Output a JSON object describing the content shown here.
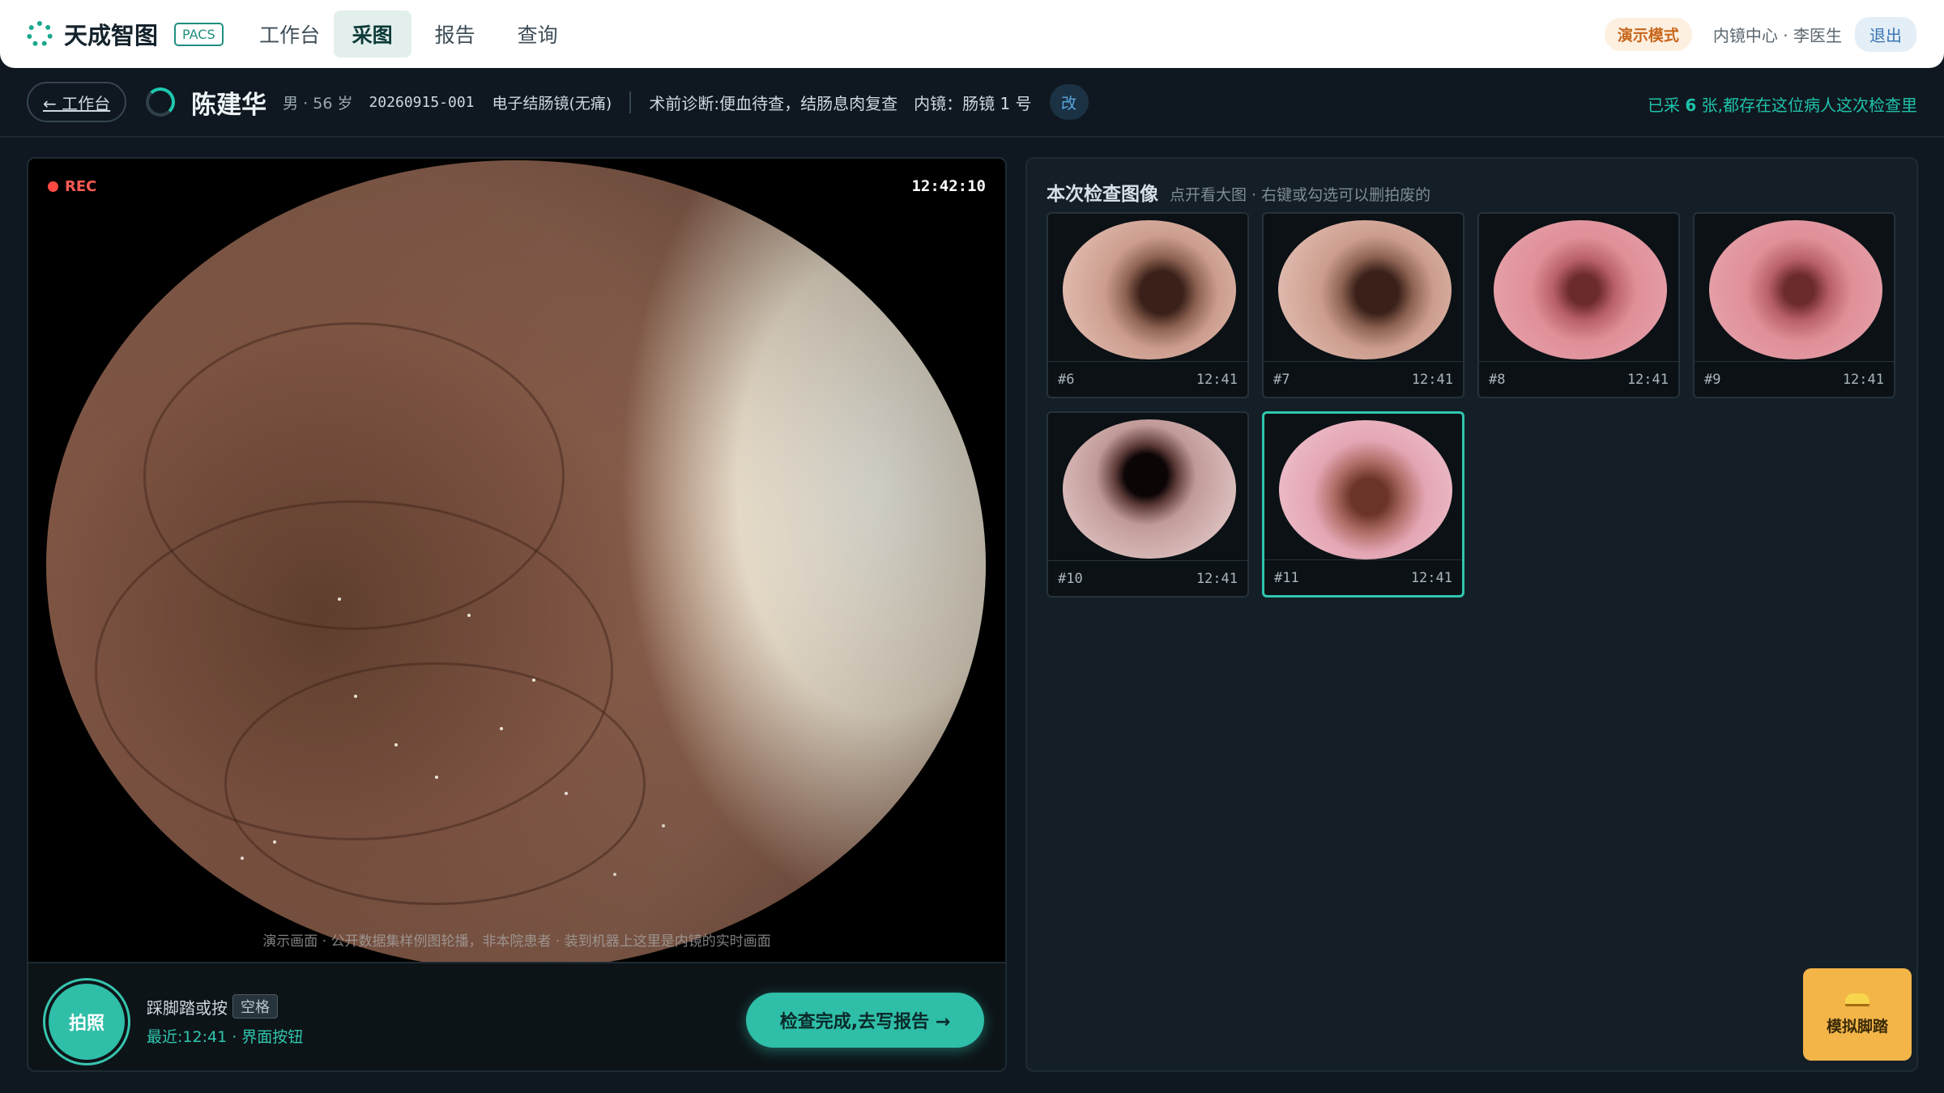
{
  "app": {
    "name": "天成智图",
    "tag": "PACS"
  },
  "nav": {
    "items": [
      {
        "label": "工作台",
        "active": false
      },
      {
        "label": "采图",
        "active": true
      },
      {
        "label": "报告",
        "active": false
      },
      {
        "label": "查询",
        "active": false
      }
    ]
  },
  "top_right": {
    "demo_mode": "演示模式",
    "user": "内镜中心 · 李医生",
    "logout": "退出"
  },
  "patient": {
    "back_label": "← 工作台",
    "name": "陈建华",
    "meta": "男 · 56 岁",
    "exam_id": "20260915-001",
    "exam_type": "电子结肠镜(无痛)",
    "diagnosis": "术前诊断:便血待查，结肠息肉复查",
    "scope": "内镜：肠镜 1 号",
    "edit_label": "改",
    "captured_prefix": "已采",
    "captured_count": "6",
    "captured_suffix": "张,都存在这位病人这次检查里"
  },
  "video": {
    "rec_label": "REC",
    "time": "12:42:10",
    "caption": "演示画面 · 公开数据集样例图轮播，非本院患者 · 装到机器上这里是内镜的实时画面"
  },
  "controls": {
    "shoot_label": "拍照",
    "pedal_hint": "踩脚踏或按",
    "space_key": "空格",
    "last_shot": "最近:12:41 · 界面按钮",
    "finish_label": "检查完成,去写报告 →"
  },
  "gallery": {
    "title": "本次检查图像",
    "subtitle": "点开看大图 · 右键或勾选可以删拍废的",
    "images": [
      {
        "num": "#6",
        "time": "12:41",
        "selected": false
      },
      {
        "num": "#7",
        "time": "12:41",
        "selected": false
      },
      {
        "num": "#8",
        "time": "12:41",
        "selected": false
      },
      {
        "num": "#9",
        "time": "12:41",
        "selected": false
      },
      {
        "num": "#10",
        "time": "12:41",
        "selected": false
      },
      {
        "num": "#11",
        "time": "12:41",
        "selected": true
      }
    ]
  },
  "simulate": {
    "label": "模拟脚踏"
  },
  "colors": {
    "accent": "#2fbea8",
    "background": "#0f1820",
    "rec": "#ff4a42",
    "pedal": "#f3b548"
  }
}
